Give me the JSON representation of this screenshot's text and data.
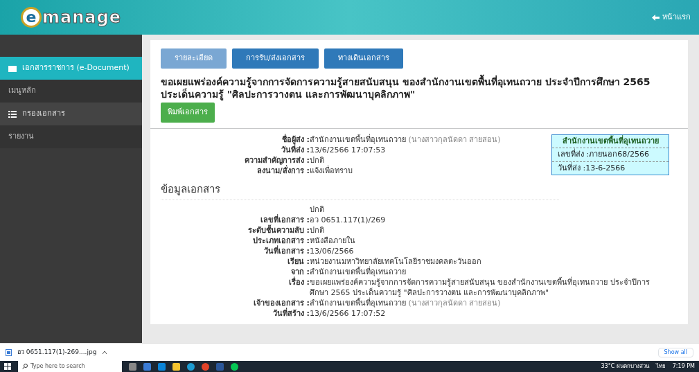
{
  "header": {
    "logo_letter": "e",
    "logo_text": "manage",
    "home_link": "หน้าแรก"
  },
  "sidebar": {
    "items": [
      {
        "label": "เอกสารราชการ (e-Document)",
        "kind": "folder",
        "selected": true
      },
      {
        "label": "เมนูหลัก",
        "kind": "heading",
        "selected": false
      },
      {
        "label": "กรองเอกสาร",
        "kind": "list",
        "selected": false
      },
      {
        "label": "รายงาน",
        "kind": "heading",
        "selected": false
      }
    ]
  },
  "tabs": [
    {
      "label": "รายละเอียด",
      "selected": true
    },
    {
      "label": "การรับ/ส่งเอกสาร",
      "selected": false
    },
    {
      "label": "ทางเดินเอกสาร",
      "selected": false
    }
  ],
  "title": "ขอเผยแพร่องค์ความรู้จากการจัดการความรู้สายสนับสนุน ของสำนักงานเขตพื้นที่อุเทนถวาย ประจำปีการศึกษา 2565 ประเด็นความรู้ \"ศิลปะการวางตน และการพัฒนาบุคลิกภาพ\"",
  "print_button": "พิมพ์เอกสาร",
  "sender_fields": [
    {
      "label": "ชื่อผู้ส่ง :",
      "value": "สำนักงานเขตพื้นที่อุเทนถวาย",
      "note": "(นางสาวกุลนัดดา สายสอน)"
    },
    {
      "label": "วันที่ส่ง :",
      "value": "13/6/2566 17:07:53"
    },
    {
      "label": "ความสำคัญการส่ง :",
      "value": "ปกติ"
    },
    {
      "label": "ลงนาม/สั่งการ :",
      "value": "แจ้งเพื่อทราบ"
    }
  ],
  "stamp": {
    "title": "สำนักงานเขตพื้นที่อุเทนถวาย",
    "lines": [
      "เลขที่ส่ง :ภายนอก68/2566",
      "วันที่ส่ง :13-6-2566"
    ]
  },
  "section_heading": "ข้อมูลเอกสาร",
  "doc_fields": [
    {
      "value": "ปกติ"
    },
    {
      "label": "เลขที่เอกสาร :",
      "value": "อว 0651.117(1)/269"
    },
    {
      "label": "ระดับชั้นความลับ :",
      "value": "ปกติ"
    },
    {
      "label": "ประเภทเอกสาร :",
      "value": "หนังสือภายใน"
    },
    {
      "label": "วันที่เอกสาร :",
      "value": "13/06/2566"
    },
    {
      "label": "เรียน :",
      "value": "หน่วยงานมหาวิทยาลัยเทคโนโลยีราชมงคลตะวันออก"
    },
    {
      "label": "จาก :",
      "value": "สำนักงานเขตพื้นที่อุเทนถวาย"
    },
    {
      "label": "เรื่อง :",
      "value": "ขอเผยแพร่องค์ความรู้จากการจัดการความรู้สายสนับสนุน ของสำนักงานเขตพื้นที่อุเทนถวาย ประจำปีการศึกษา 2565 ประเด็นความรู้ \"ศิลปะการวางตน และการพัฒนาบุคลิกภาพ\""
    },
    {
      "label": "เจ้าของเอกสาร :",
      "value": "สำนักงานเขตพื้นที่อุเทนถวาย",
      "note": "(นางสาวกุลนัดดา สายสอน)"
    },
    {
      "label": "วันที่สร้าง :",
      "value": "13/6/2566 17:07:52"
    }
  ],
  "download_bar": {
    "file": "อว 0651.117(1)-269....jpg",
    "show_all": "Show all"
  },
  "taskbar": {
    "search_placeholder": "Type here to search",
    "weather": "33°C ฝนตกบางส่วน",
    "language": "ไทย",
    "time": "7:19 PM"
  }
}
